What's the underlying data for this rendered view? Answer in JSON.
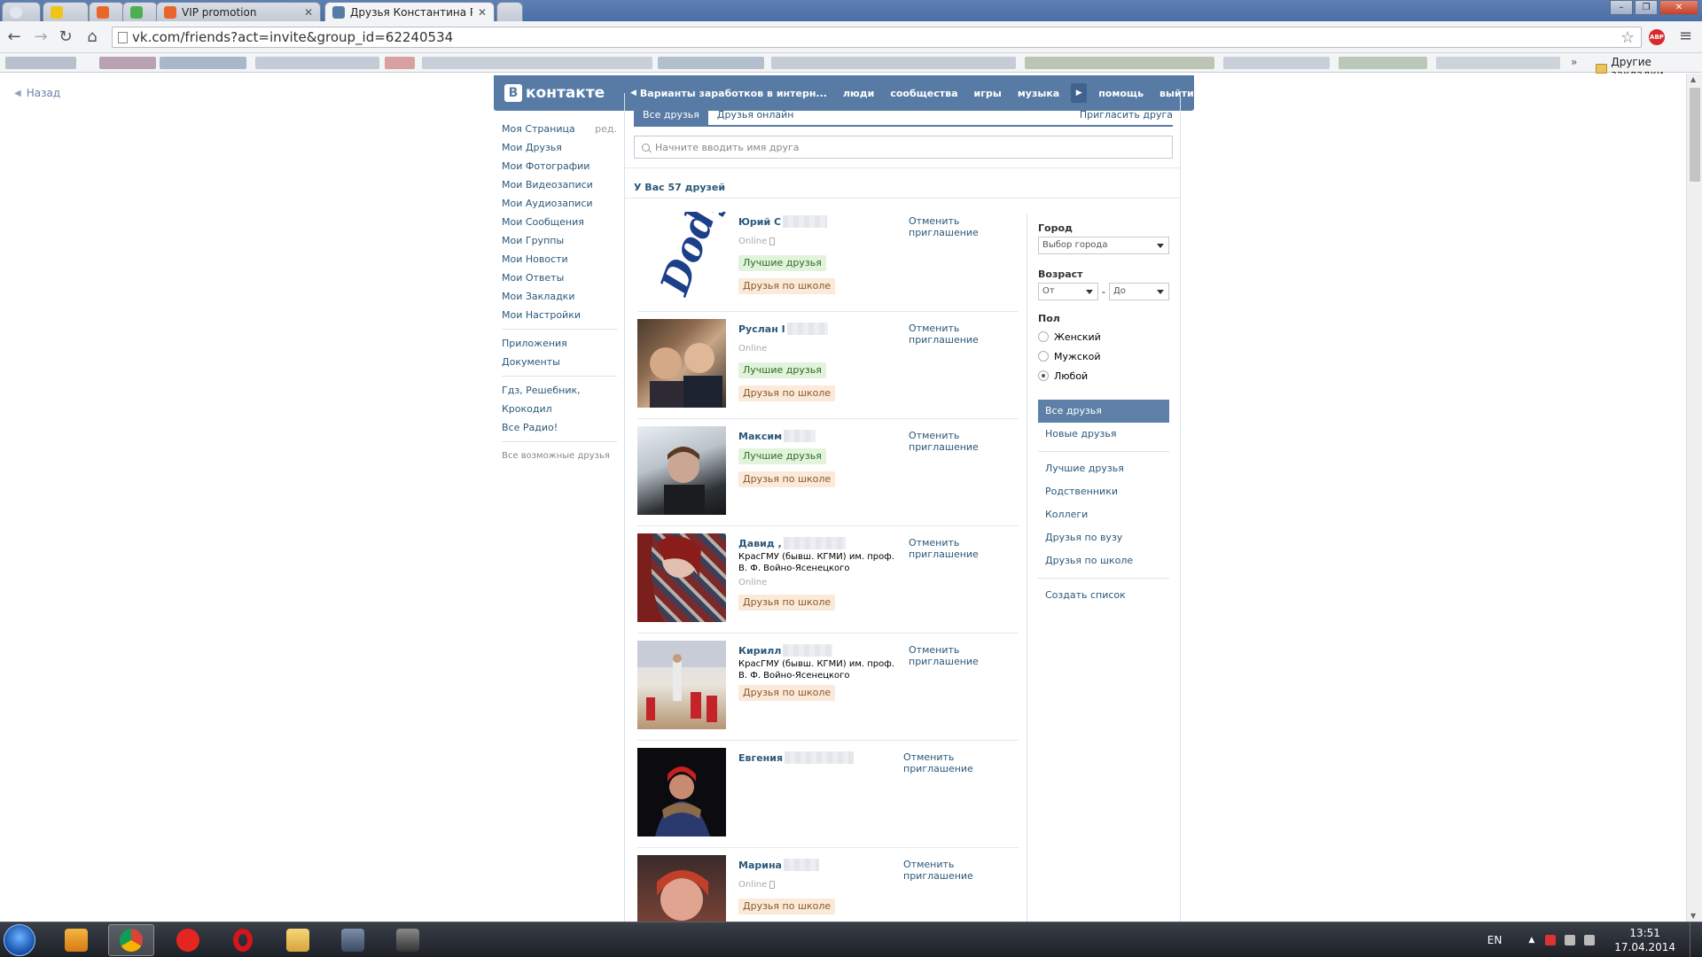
{
  "browser": {
    "tabs": [
      {
        "label": "",
        "color": "#f0c419"
      },
      {
        "label": "",
        "color": "#e8662a"
      },
      {
        "label": "",
        "color": "#4caf50"
      },
      {
        "label": "VIP promotion",
        "color": "#e8662a"
      },
      {
        "label": "Друзья Константина Руд",
        "color": "#587ba6",
        "active": true
      }
    ],
    "url": "vk.com/friends?act=invite&group_id=62240534",
    "bookmarks_other": "Другие закладки",
    "bookmarks_more": "»"
  },
  "page": {
    "back": "Назад",
    "header": {
      "logo": "контакте",
      "logo_letter": "В",
      "menu": [
        "Варианты заработков в интерн...",
        "люди",
        "сообщества",
        "игры",
        "музыка",
        "помощь",
        "выйти"
      ]
    },
    "left_nav": {
      "items": [
        "Моя Страница",
        "Мои Друзья",
        "Мои Фотографии",
        "Мои Видеозаписи",
        "Мои Аудиозаписи",
        "Мои Сообщения",
        "Мои Группы",
        "Мои Новости",
        "Мои Ответы",
        "Мои Закладки",
        "Мои Настройки"
      ],
      "edit": "ред.",
      "apps": [
        "Приложения",
        "Документы"
      ],
      "custom": [
        "Гдз, Решебник,",
        "Крокодил",
        "Все Радио!"
      ],
      "possible": "Все возможные друзья"
    },
    "tabs": {
      "all": "Все друзья",
      "online": "Друзья онлайн",
      "invite": "Пригласить друга"
    },
    "search_placeholder": "Начните вводить имя друга",
    "count": "У Вас 57 друзей",
    "friends": [
      {
        "name": "Юрий С",
        "online": "Online",
        "tags": [
          "Лучшие друзья",
          "Друзья по школе"
        ],
        "cancel": "Отменить приглашение"
      },
      {
        "name": "Руслан I",
        "online": "Online",
        "tags": [
          "Лучшие друзья",
          "Друзья по школе"
        ],
        "cancel": "Отменить приглашение"
      },
      {
        "name": "Максим",
        "tags": [
          "Лучшие друзья",
          "Друзья по школе"
        ],
        "cancel": "Отменить приглашение"
      },
      {
        "name": "Давид ,",
        "edu": "КрасГМУ (бывш. КГМИ) им. проф. В. Ф. Войно-Ясенецкого",
        "online": "Online",
        "tags": [
          "Друзья по школе"
        ],
        "cancel": "Отменить приглашение"
      },
      {
        "name": "Кирилл",
        "edu": "КрасГМУ (бывш. КГМИ) им. проф. В. Ф. Войно-Ясенецкого",
        "tags": [
          "Друзья по школе"
        ],
        "cancel": "Отменить приглашение"
      },
      {
        "name": "Евгения",
        "tags": [],
        "cancel": "Отменить приглашение"
      },
      {
        "name": "Марина",
        "online": "Online",
        "tags": [
          "Друзья по школе"
        ],
        "cancel": "Отменить приглашение"
      }
    ],
    "filters": {
      "city_label": "Город",
      "city_value": "Выбор города",
      "age_label": "Возраст",
      "age_from": "От",
      "age_dash": "-",
      "age_to": "До",
      "sex_label": "Пол",
      "sex_options": [
        "Женский",
        "Мужской",
        "Любой"
      ],
      "sex_selected": "Любой",
      "lists": [
        "Все друзья",
        "Новые друзья"
      ],
      "lists2": [
        "Лучшие друзья",
        "Родственники",
        "Коллеги",
        "Друзья по вузу",
        "Друзья по школе"
      ],
      "create": "Создать список"
    }
  },
  "taskbar": {
    "lang": "EN",
    "time": "13:51",
    "date": "17.04.2014"
  }
}
